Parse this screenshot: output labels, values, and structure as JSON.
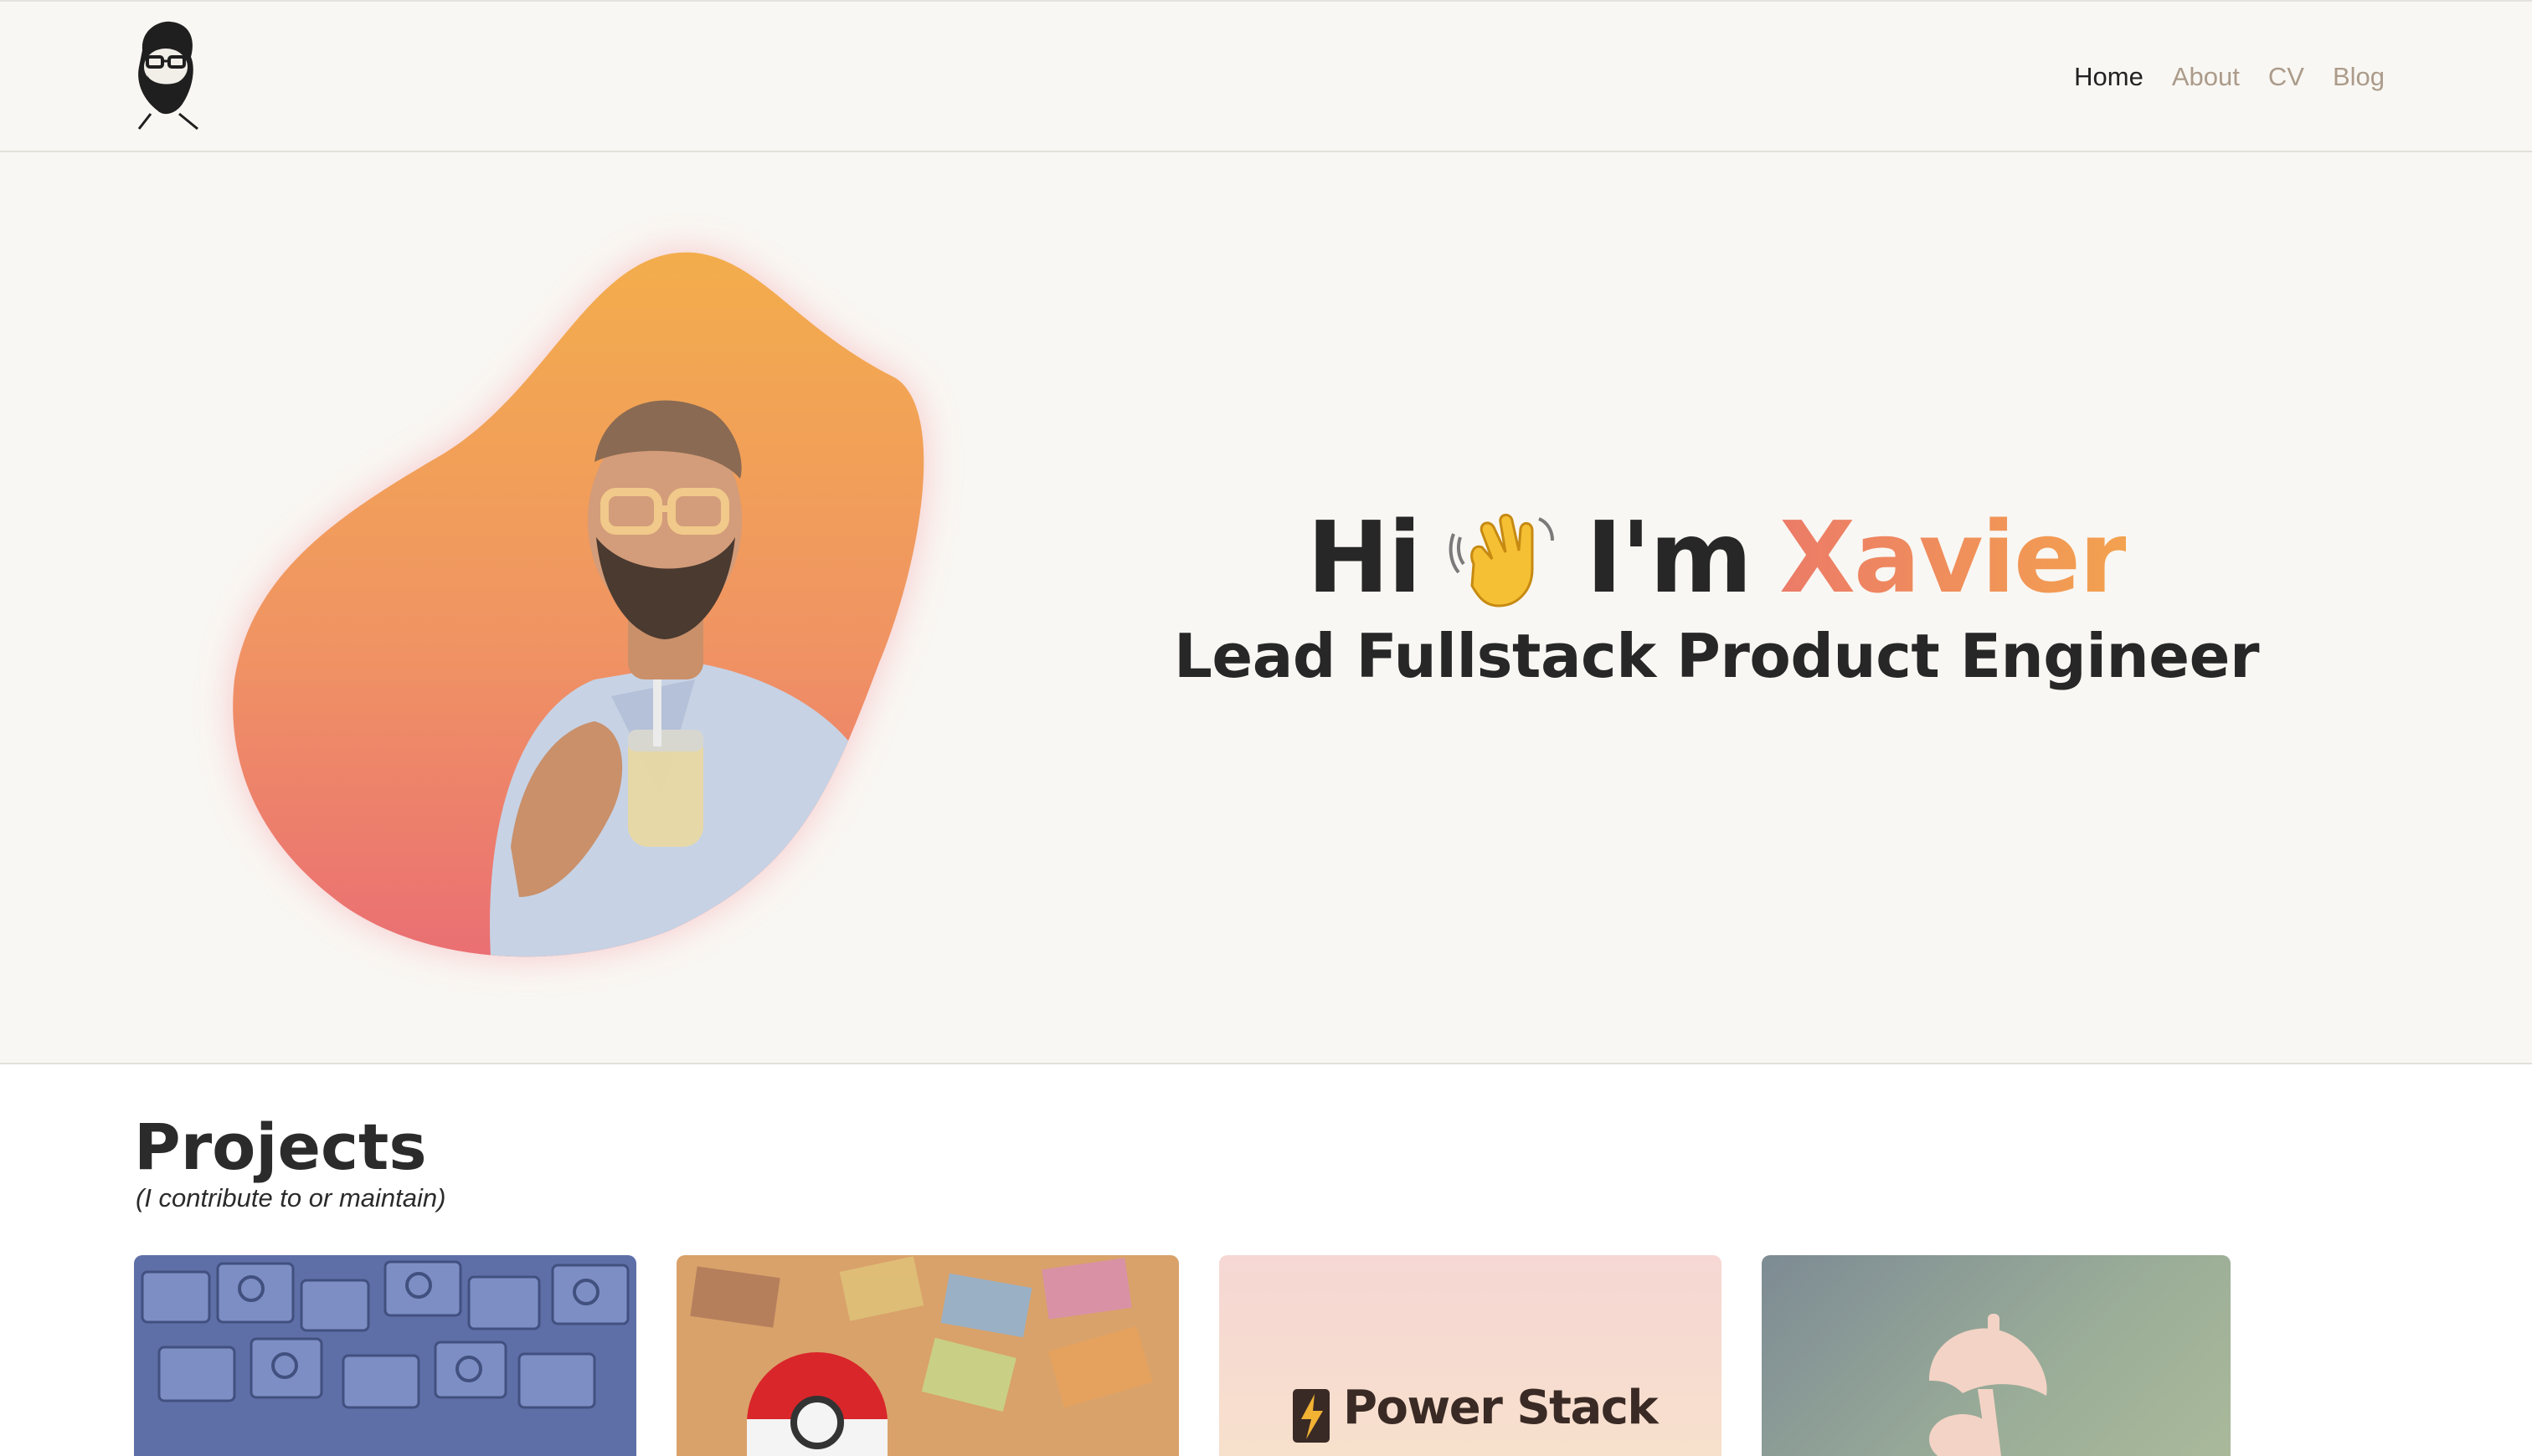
{
  "nav": {
    "logo_icon": "bearded-face-avatar-icon",
    "links": [
      "Home",
      "About",
      "CV",
      "Blog"
    ],
    "active": "Home"
  },
  "hero": {
    "greeting_hi": "Hi",
    "wave_icon": "waving-hand-icon",
    "greeting_im": "I'm",
    "name": "Xavier",
    "subtitle": "Lead Fullstack Product Engineer",
    "gradient_colors": [
      "#f3a24f",
      "#ec7b68"
    ]
  },
  "projects": {
    "title": "Projects",
    "subtitle": "(I contribute to or maintain)",
    "cards": [
      {
        "image": "blue-lego-bricks-image"
      },
      {
        "image": "pokeball-cards-image"
      },
      {
        "label": "Power Stack",
        "icon": "lightning-battery-icon"
      },
      {
        "image": "beach-umbrella-image"
      }
    ]
  }
}
